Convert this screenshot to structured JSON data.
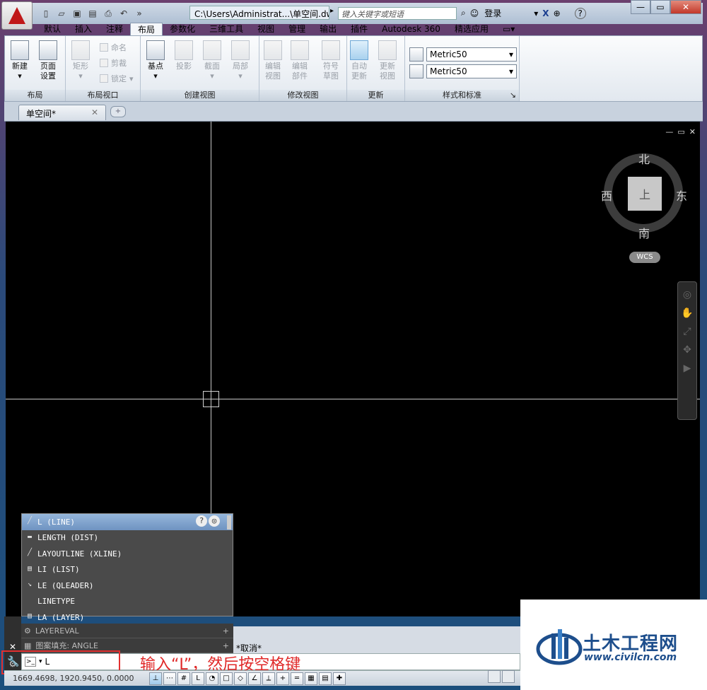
{
  "titlebar": {
    "title": "C:\\Users\\Administrat...\\单空间.dwg",
    "search_placeholder": "键入关键字或短语",
    "login": "登录"
  },
  "ribbon_tabs": [
    "默认",
    "插入",
    "注释",
    "布局",
    "参数化",
    "三维工具",
    "视图",
    "管理",
    "输出",
    "插件",
    "Autodesk 360",
    "精选应用"
  ],
  "active_tab": "布局",
  "panels": {
    "layout": {
      "title": "布局",
      "new": "新建",
      "page_setup_1": "页面",
      "page_setup_2": "设置"
    },
    "layout_viewport": {
      "title": "布局视口",
      "rect": "矩形",
      "name": "命名",
      "clip": "剪裁",
      "lock": "锁定"
    },
    "create_view": {
      "title": "创建视图",
      "base": "基点",
      "projected": "投影",
      "section": "截面",
      "detail": "局部"
    },
    "modify_view": {
      "title": "修改视图",
      "edit_view_1": "编辑",
      "edit_view_2": "视图",
      "edit_comp_1": "编辑",
      "edit_comp_2": "部件",
      "symbol_1": "符号",
      "symbol_2": "草图"
    },
    "update": {
      "title": "更新",
      "auto_1": "自动",
      "auto_2": "更新",
      "update_view_1": "更新",
      "update_view_2": "视图"
    },
    "styles": {
      "title": "样式和标准",
      "style1": "Metric50",
      "style2": "Metric50"
    }
  },
  "doc_tab": "单空间*",
  "viewcube": {
    "north": "北",
    "south": "南",
    "west": "西",
    "east": "东",
    "face": "上",
    "wcs": "WCS"
  },
  "autocomplete": [
    "L (LINE)",
    "LENGTH (DIST)",
    "LAYOUTLINE (XLINE)",
    "LI (LIST)",
    "LE (QLEADER)",
    "LINETYPE",
    "LA (LAYER)"
  ],
  "cmd_history": {
    "row1": "LAYEREVAL",
    "row2": "图案填充: ANGLE",
    "cancel": "*取消*"
  },
  "command_input": "L",
  "annotation": "输入“L”，然后按空格键",
  "status": {
    "coords": "1669.4698, 1920.9450, 0.0000"
  },
  "watermark": {
    "title": "土木工程网",
    "url": "www.civilcn.com"
  }
}
